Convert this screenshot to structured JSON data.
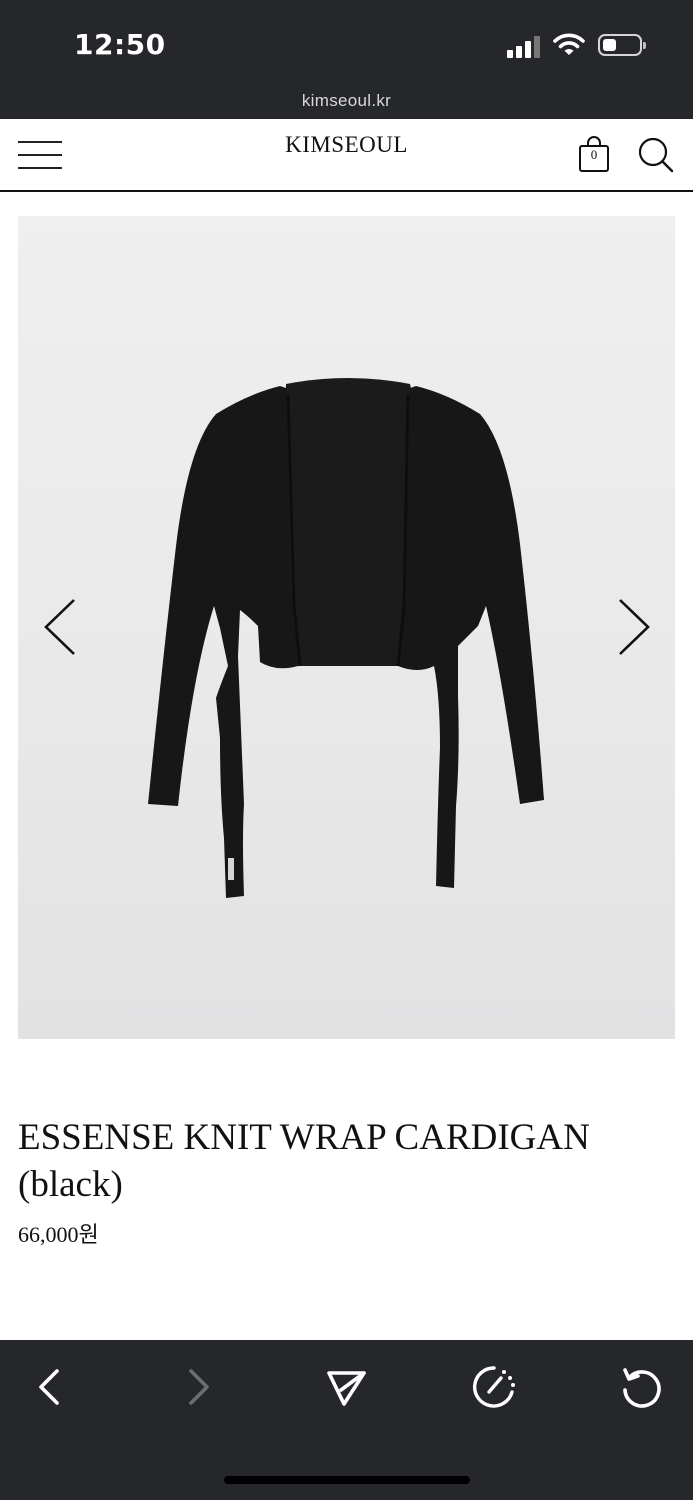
{
  "status_bar": {
    "time": "12:50",
    "url": "kimseoul.kr"
  },
  "header": {
    "logo": "KIMSEOUL",
    "cart_count": "0",
    "menu_icon": "hamburger-menu-icon",
    "cart_icon": "shopping-bag-icon",
    "search_icon": "search-icon"
  },
  "product": {
    "image_alt": "black knit wrap cardigan",
    "title": "ESSENSE KNIT WRAP CARDIGAN (black)",
    "price": "66,000원"
  },
  "gallery": {
    "prev_icon": "chevron-left-icon",
    "next_icon": "chevron-right-icon"
  },
  "toolbar": {
    "items": [
      "back-icon",
      "forward-icon",
      "share-icon",
      "speed-icon",
      "reload-icon"
    ]
  },
  "colors": {
    "chrome_dark": "#25272b",
    "text": "#111111",
    "image_bg": "#ececec"
  }
}
